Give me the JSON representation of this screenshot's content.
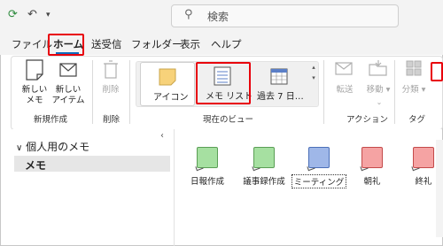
{
  "titlebar": {
    "search_placeholder": "検索"
  },
  "menu": {
    "tabs": [
      "ファイル",
      "ホーム",
      "送受信",
      "フォルダー",
      "表示",
      "ヘルプ"
    ],
    "active": "ホーム"
  },
  "ribbon": {
    "new_note": "新しい\nメモ",
    "new_item": "新しい\nアイテム",
    "new_group": "新規作成",
    "delete": "削除",
    "delete_group": "削除",
    "view_icon": "アイコン",
    "view_list": "メモ リスト",
    "view_last7": "過去 7 日…",
    "view_group": "現在のビュー",
    "forward": "転送",
    "move": "移動",
    "action_group": "アクション",
    "categorize": "分類",
    "tag_group": "タグ"
  },
  "sidebar": {
    "section": "個人用のメモ",
    "item": "メモ"
  },
  "notes": [
    {
      "label": "日報作成",
      "color": "#a6e0a1"
    },
    {
      "label": "議事録作成",
      "color": "#a6e0a1"
    },
    {
      "label": "ミーティング",
      "color": "#9fb7e8"
    },
    {
      "label": "朝礼",
      "color": "#f5a3a3"
    },
    {
      "label": "終礼",
      "color": "#f5a3a3"
    }
  ]
}
